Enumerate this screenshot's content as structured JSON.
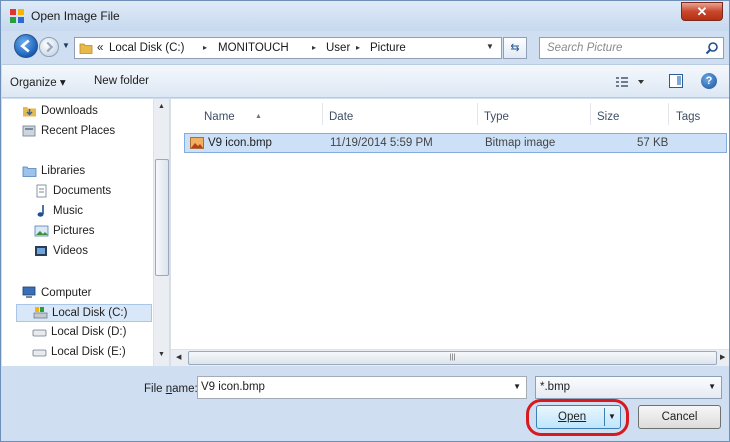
{
  "window": {
    "title": "Open Image File",
    "close_glyph": "✕"
  },
  "address": {
    "overflow_glyph": "«",
    "segments": [
      "Local Disk (C:)",
      "MONITOUCH",
      "User",
      "Picture"
    ],
    "separator_glyph": "▸"
  },
  "search": {
    "placeholder": "Search Picture"
  },
  "toolbar": {
    "organize_label": "Organize ▾",
    "new_folder_label": "New folder",
    "help_glyph": "?"
  },
  "nav_tree": {
    "favorites": [
      {
        "label": "Downloads",
        "icon": "downloads-icon"
      },
      {
        "label": "Recent Places",
        "icon": "recent-places-icon"
      }
    ],
    "libraries_label": "Libraries",
    "libraries": [
      {
        "label": "Documents",
        "icon": "documents-icon"
      },
      {
        "label": "Music",
        "icon": "music-icon"
      },
      {
        "label": "Pictures",
        "icon": "pictures-icon"
      },
      {
        "label": "Videos",
        "icon": "videos-icon"
      }
    ],
    "computer_label": "Computer",
    "drives": [
      {
        "label": "Local Disk (C:)",
        "icon": "drive-icon",
        "selected": true
      },
      {
        "label": "Local Disk (D:)",
        "icon": "drive-icon",
        "selected": false
      },
      {
        "label": "Local Disk (E:)",
        "icon": "drive-icon",
        "selected": false
      }
    ]
  },
  "file_list": {
    "columns": [
      "Name",
      "Date",
      "Type",
      "Size",
      "Tags"
    ],
    "rows": [
      {
        "name": "V9 icon.bmp",
        "date": "11/19/2014 5:59 PM",
        "type": "Bitmap image",
        "size": "57 KB",
        "tags": ""
      }
    ]
  },
  "bottom": {
    "filename_label": "File name:",
    "filename_label_prefix": "File ",
    "filename_label_accel": "n",
    "filename_label_suffix": "ame:",
    "filename_value": "V9 icon.bmp",
    "filetype_value": "*.bmp",
    "open_label": "Open",
    "cancel_label": "Cancel"
  },
  "colors": {
    "accent_ring": "#d71920",
    "selection": "#cce1f8",
    "window_frame": "#cfdff1"
  }
}
